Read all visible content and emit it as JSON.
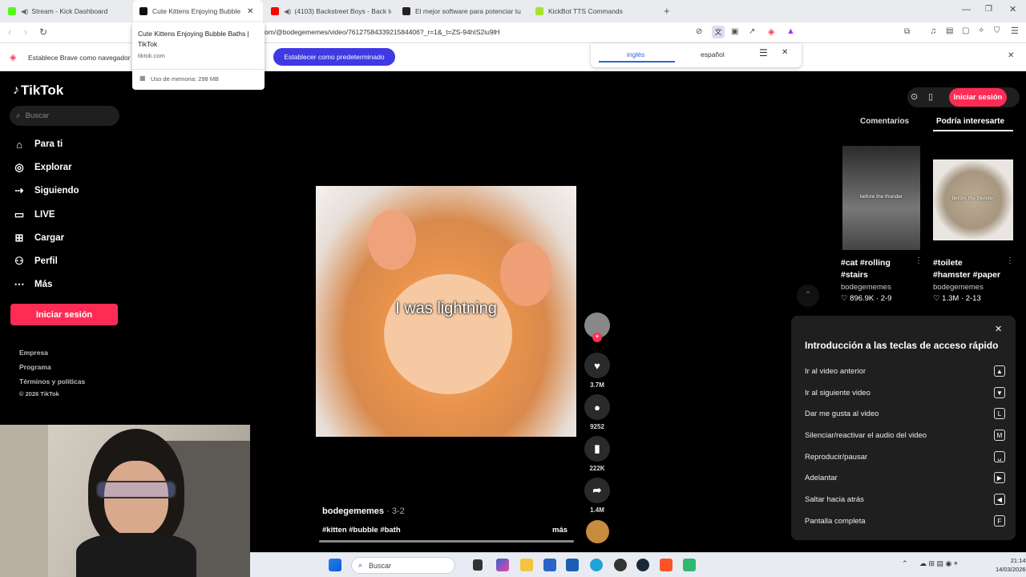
{
  "browser": {
    "tabs": [
      {
        "label": "Stream - Kick Dashboard",
        "color": "#53fc18"
      },
      {
        "label": "Cute Kittens Enjoying Bubble Ba",
        "color": "#111111"
      },
      {
        "label": "(4103) Backstreet Boys - Back to",
        "color": "#ff0000"
      },
      {
        "label": "El mejor software para potenciar tu s",
        "color": "#222222"
      },
      {
        "label": "KickBot TTS Commands",
        "color": "#a6e22e"
      }
    ],
    "url": "om/@bodegememes/video/7612758433921584406?_r=1&_t=ZS-94hIS2iu9lH",
    "tooltip": {
      "title": "Cute Kittens Enjoying Bubble Baths | TikTok",
      "domain": "tiktok.com",
      "memory": "Uso de memoria: 298 MB"
    },
    "infobar": {
      "text": "Establece Brave como navegador",
      "button": "Establecer como predeterminado"
    },
    "translate": {
      "lang1": "inglés",
      "lang2": "español"
    }
  },
  "tiktok": {
    "logo": "TikTok",
    "search_placeholder": "Buscar",
    "nav": [
      "Para ti",
      "Explorar",
      "Siguiendo",
      "LIVE",
      "Cargar",
      "Perfil",
      "Más"
    ],
    "login": "Iniciar sesión",
    "footer": [
      "Empresa",
      "Programa",
      "Términos y políticas",
      "© 2026 TikTok"
    ],
    "video": {
      "caption": "I was lightning",
      "author": "bodegememes",
      "date": "· 3-2",
      "tags": "#kitten #bubble #bath",
      "more": "más"
    },
    "actions": {
      "likes": "3.7M",
      "comments": "9252",
      "saves": "222K",
      "shares": "1.4M"
    },
    "right": {
      "login": "Iniciar sesión",
      "tabs": [
        "Comentarios",
        "Podría interesarte"
      ],
      "cards": [
        {
          "overlay": "before the thunder",
          "title": "#cat #rolling #stairs",
          "author": "bodegememes",
          "stats": "♡ 896.9K · 2-9"
        },
        {
          "overlay": "before the thunder",
          "title": "#toilete #hamster #paper",
          "author": "bodegememes",
          "stats": "♡ 1.3M · 2-13"
        }
      ]
    },
    "shortcuts": {
      "title": "Introducción a las teclas de acceso rápido",
      "items": [
        {
          "label": "Ir al video anterior",
          "key": "▲"
        },
        {
          "label": "Ir al siguiente video",
          "key": "▼"
        },
        {
          "label": "Dar me gusta al video",
          "key": "L"
        },
        {
          "label": "Silenciar/reactivar el audio del video",
          "key": "M"
        },
        {
          "label": "Reproducir/pausar",
          "key": "␣"
        },
        {
          "label": "Adelantar",
          "key": "▶"
        },
        {
          "label": "Saltar hacia atrás",
          "key": "◀"
        },
        {
          "label": "Pantalla completa",
          "key": "F"
        }
      ]
    }
  },
  "taskbar": {
    "search": "Buscar",
    "time": "21:14",
    "date": "14/03/2026"
  }
}
